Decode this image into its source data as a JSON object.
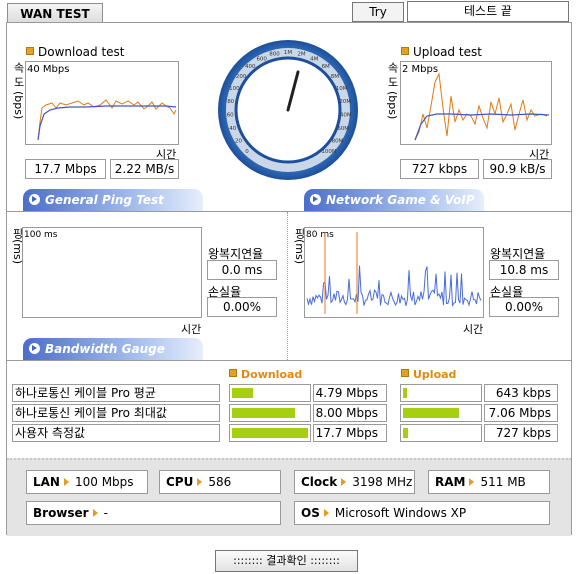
{
  "header": {
    "tab_label": "WAN TEST",
    "try_again_label": "Try again",
    "status_text": "테스트 끝"
  },
  "download_test": {
    "title": "Download test",
    "scale_label": "40 Mbps",
    "y_label": "속 도 (bps)",
    "x_label": "시간",
    "speed_bps": "17.7 Mbps",
    "speed_bytes": "2.22 MB/s"
  },
  "upload_test": {
    "title": "Upload test",
    "scale_label": "2 Mbps",
    "y_label": "속 도 (bps)",
    "x_label": "시간",
    "speed_bps": "727 kbps",
    "speed_bytes": "90.9 kB/s"
  },
  "gauge": {
    "ticks": [
      "0",
      "20",
      "40",
      "60",
      "80",
      "100",
      "200",
      "400",
      "600",
      "800",
      "1M",
      "2M",
      "4M",
      "6M",
      "8M",
      "10M",
      "20M",
      "40M",
      "60M",
      "80M",
      "100M"
    ],
    "needle_value": "17.7M"
  },
  "ping_test": {
    "title": "General Ping Test",
    "scale_label": "100 ms",
    "y_label": "핑(ms)",
    "x_label": "시간",
    "latency_label": "왕복지연율",
    "latency_value": "0.0 ms",
    "loss_label": "손실율",
    "loss_value": "0.00%"
  },
  "game_test": {
    "title": "Network Game & VoIP Test",
    "scale_label": "80 ms",
    "y_label": "핑(ms)",
    "x_label": "시간",
    "latency_label": "왕복지연율",
    "latency_value": "10.8 ms",
    "loss_label": "손실율",
    "loss_value": "0.00%"
  },
  "bandwidth": {
    "title": "Bandwidth Gauge",
    "download_header": "Download",
    "upload_header": "Upload",
    "rows": [
      {
        "label": "하나로통신 케이블 Pro 평균",
        "download": "4.79 Mbps",
        "download_level": 0.27,
        "upload": "643 kbps",
        "upload_level": 0.05
      },
      {
        "label": "하나로통신 케이블 Pro 최대값",
        "download": "8.00 Mbps",
        "download_level": 0.83,
        "upload": "7.06 Mbps",
        "upload_level": 0.74
      },
      {
        "label": "사용자 측정값",
        "download": "17.7 Mbps",
        "download_level": 1.0,
        "upload": "727 kbps",
        "upload_level": 0.07
      }
    ]
  },
  "system": {
    "lan_label": "LAN",
    "lan_value": "100 Mbps",
    "cpu_label": "CPU",
    "cpu_value": "586",
    "clock_label": "Clock",
    "clock_value": "3198 MHz",
    "ram_label": "RAM",
    "ram_value": "511 MB",
    "browser_label": "Browser",
    "browser_value": "-",
    "os_label": "OS",
    "os_value": "Microsoft Windows XP"
  },
  "footer": {
    "confirm_label": ":::::::: 결과확인 ::::::::"
  },
  "colors": {
    "accent_orange": "#e39b22",
    "bar_green": "#a6cf12",
    "tab_blue": "#4b6ec9",
    "trace_blue": "#4a6be0"
  }
}
